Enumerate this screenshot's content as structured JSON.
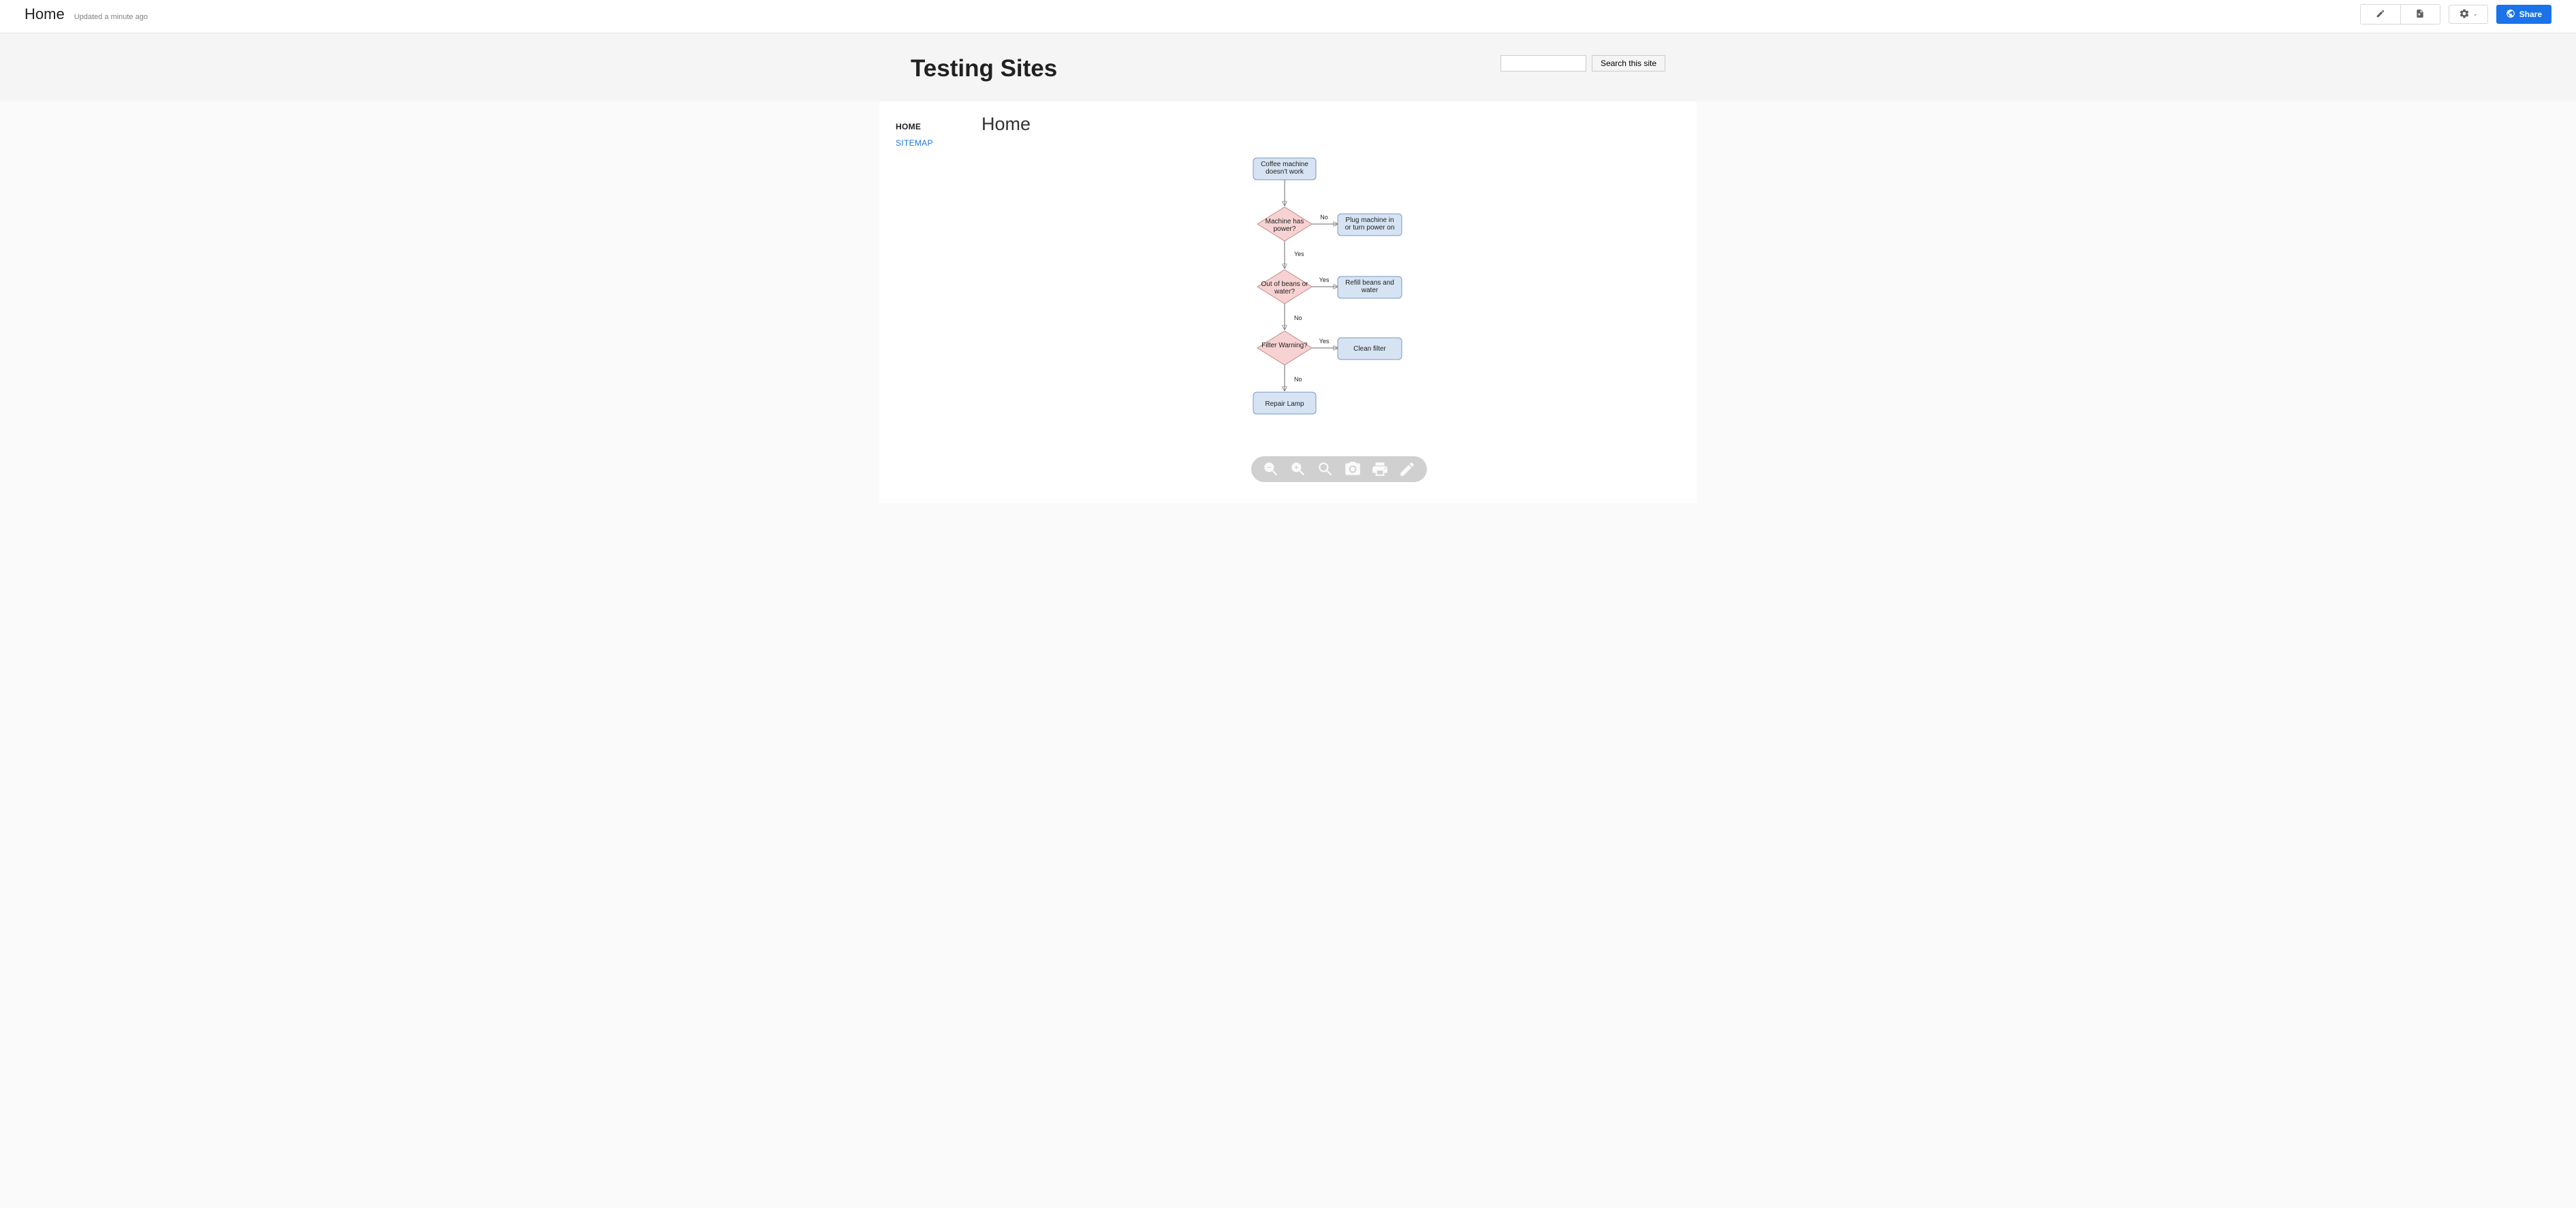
{
  "topbar": {
    "title": "Home",
    "updated": "Updated a minute ago",
    "share_label": "Share"
  },
  "site": {
    "title": "Testing Sites",
    "search_button": "Search this site"
  },
  "sidebar": {
    "items": [
      {
        "label": "HOME"
      },
      {
        "label": "SITEMAP"
      }
    ]
  },
  "page": {
    "heading": "Home"
  },
  "flowchart": {
    "nodes": {
      "start": "Coffee machine doesn't work",
      "d1": "Machine has power?",
      "a1": "Plug machine in or turn power on",
      "d2": "Out of beans or water?",
      "a2": "Refill beans and water",
      "d3": "Filter Warning?",
      "a3": "Clean filter",
      "end": "Repair Lamp"
    },
    "labels": {
      "d1_right": "No",
      "d1_down": "Yes",
      "d2_right": "Yes",
      "d2_down": "No",
      "d3_right": "Yes",
      "d3_down": "No"
    }
  }
}
